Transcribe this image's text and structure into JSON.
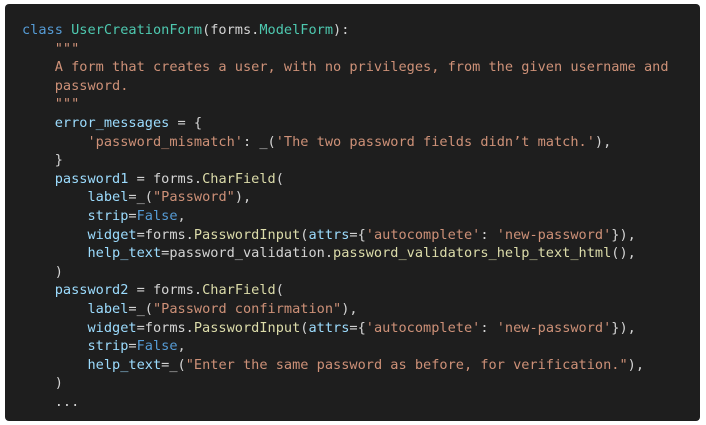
{
  "lines": [
    [
      [
        "t-kw",
        "class "
      ],
      [
        "t-cls",
        "UserCreationForm"
      ],
      [
        "t-punc",
        "("
      ],
      [
        "t-plain",
        "forms."
      ],
      [
        "t-cls",
        "ModelForm"
      ],
      [
        "t-punc",
        "):"
      ]
    ],
    [
      [
        "t-doc",
        "    \"\"\""
      ]
    ],
    [
      [
        "t-doc",
        "    A form that creates a user, with no privileges, from the given username and"
      ]
    ],
    [
      [
        "t-doc",
        "    password."
      ]
    ],
    [
      [
        "t-doc",
        "    \"\"\""
      ]
    ],
    [
      [
        "t-var",
        "    error_messages"
      ],
      [
        "t-plain",
        " = {"
      ]
    ],
    [
      [
        "t-plain",
        "        "
      ],
      [
        "t-str",
        "'password_mismatch'"
      ],
      [
        "t-plain",
        ": _("
      ],
      [
        "t-str",
        "'The two password fields didn’t match.'"
      ],
      [
        "t-plain",
        "),"
      ]
    ],
    [
      [
        "t-plain",
        "    }"
      ]
    ],
    [
      [
        "t-var",
        "    password1"
      ],
      [
        "t-plain",
        " = forms."
      ],
      [
        "t-fn",
        "CharField"
      ],
      [
        "t-plain",
        "("
      ]
    ],
    [
      [
        "t-param",
        "        label"
      ],
      [
        "t-plain",
        "=_("
      ],
      [
        "t-str",
        "\"Password\""
      ],
      [
        "t-plain",
        "),"
      ]
    ],
    [
      [
        "t-param",
        "        strip"
      ],
      [
        "t-plain",
        "="
      ],
      [
        "t-const",
        "False"
      ],
      [
        "t-plain",
        ","
      ]
    ],
    [
      [
        "t-param",
        "        widget"
      ],
      [
        "t-plain",
        "=forms."
      ],
      [
        "t-fn",
        "PasswordInput"
      ],
      [
        "t-plain",
        "("
      ],
      [
        "t-param",
        "attrs"
      ],
      [
        "t-plain",
        "={"
      ],
      [
        "t-str",
        "'autocomplete'"
      ],
      [
        "t-plain",
        ": "
      ],
      [
        "t-str",
        "'new-password'"
      ],
      [
        "t-plain",
        "}),"
      ]
    ],
    [
      [
        "t-param",
        "        help_text"
      ],
      [
        "t-plain",
        "=password_validation."
      ],
      [
        "t-fn",
        "password_validators_help_text_html"
      ],
      [
        "t-plain",
        "(),"
      ]
    ],
    [
      [
        "t-plain",
        "    )"
      ]
    ],
    [
      [
        "t-var",
        "    password2"
      ],
      [
        "t-plain",
        " = forms."
      ],
      [
        "t-fn",
        "CharField"
      ],
      [
        "t-plain",
        "("
      ]
    ],
    [
      [
        "t-param",
        "        label"
      ],
      [
        "t-plain",
        "=_("
      ],
      [
        "t-str",
        "\"Password confirmation\""
      ],
      [
        "t-plain",
        "),"
      ]
    ],
    [
      [
        "t-param",
        "        widget"
      ],
      [
        "t-plain",
        "=forms."
      ],
      [
        "t-fn",
        "PasswordInput"
      ],
      [
        "t-plain",
        "("
      ],
      [
        "t-param",
        "attrs"
      ],
      [
        "t-plain",
        "={"
      ],
      [
        "t-str",
        "'autocomplete'"
      ],
      [
        "t-plain",
        ": "
      ],
      [
        "t-str",
        "'new-password'"
      ],
      [
        "t-plain",
        "}),"
      ]
    ],
    [
      [
        "t-param",
        "        strip"
      ],
      [
        "t-plain",
        "="
      ],
      [
        "t-const",
        "False"
      ],
      [
        "t-plain",
        ","
      ]
    ],
    [
      [
        "t-param",
        "        help_text"
      ],
      [
        "t-plain",
        "=_("
      ],
      [
        "t-str",
        "\"Enter the same password as before, for verification.\""
      ],
      [
        "t-plain",
        "),"
      ]
    ],
    [
      [
        "t-plain",
        "    )"
      ]
    ],
    [
      [
        "t-plain",
        "    ..."
      ]
    ]
  ]
}
